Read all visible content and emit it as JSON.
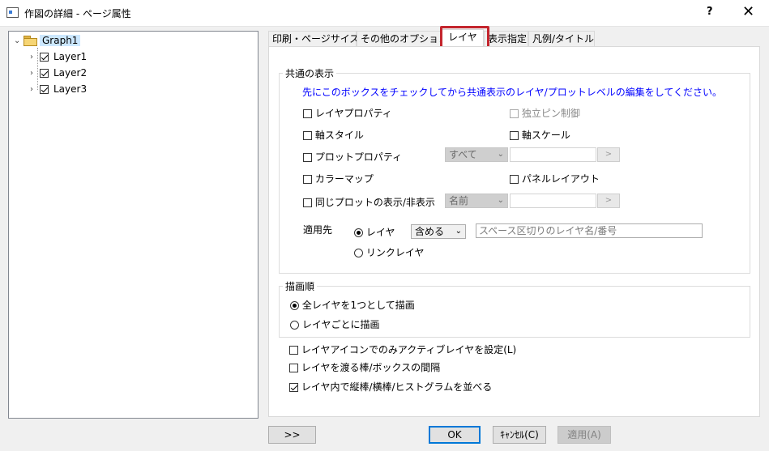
{
  "window": {
    "title": "作図の詳細 - ページ属性",
    "help": "?",
    "close": "✕"
  },
  "tree": {
    "root": "Graph1",
    "layers": [
      "Layer1",
      "Layer2",
      "Layer3"
    ]
  },
  "tabs": [
    "印刷・ページサイズ",
    "その他のオプション",
    "レイヤ",
    "表示指定",
    "凡例/タイトル"
  ],
  "active_tab": "レイヤ",
  "common_display": {
    "title": "共通の表示",
    "note": "先にこのボックスをチェックしてから共通表示のレイヤ/プロットレベルの編集をしてください。",
    "layer_properties": "レイヤプロパティ",
    "independent_pin": "独立ピン制御",
    "axis_style": "軸スタイル",
    "axis_scale": "軸スケール",
    "plot_properties": "プロットプロパティ",
    "plot_select": "すべて",
    "colormap": "カラーマップ",
    "panel_layout": "パネルレイアウト",
    "same_plot_visibility": "同じプロットの表示/非表示",
    "name_select": "名前",
    "apply_to_label": "適用先",
    "radio_layer": "レイヤ",
    "include_select": "含める",
    "layer_input_placeholder": "スペース区切りのレイヤ名/番号",
    "radio_link_layer": "リンクレイヤ",
    "next_button": ">"
  },
  "draw_order": {
    "title": "描画順",
    "all_as_one": "全レイヤを1つとして描画",
    "per_layer": "レイヤごとに描画"
  },
  "options": {
    "active_layer_icon_only": "レイヤアイコンでのみアクティブレイヤを設定(L)",
    "bar_box_gap": "レイヤを渡る棒/ボックスの間隔",
    "arrange_bars": "レイヤ内で縦棒/横棒/ヒストグラムを並べる"
  },
  "buttons": {
    "expand": ">>",
    "ok": "OK",
    "cancel": "ｷｬﾝｾﾙ(C)",
    "apply": "適用(A)"
  }
}
